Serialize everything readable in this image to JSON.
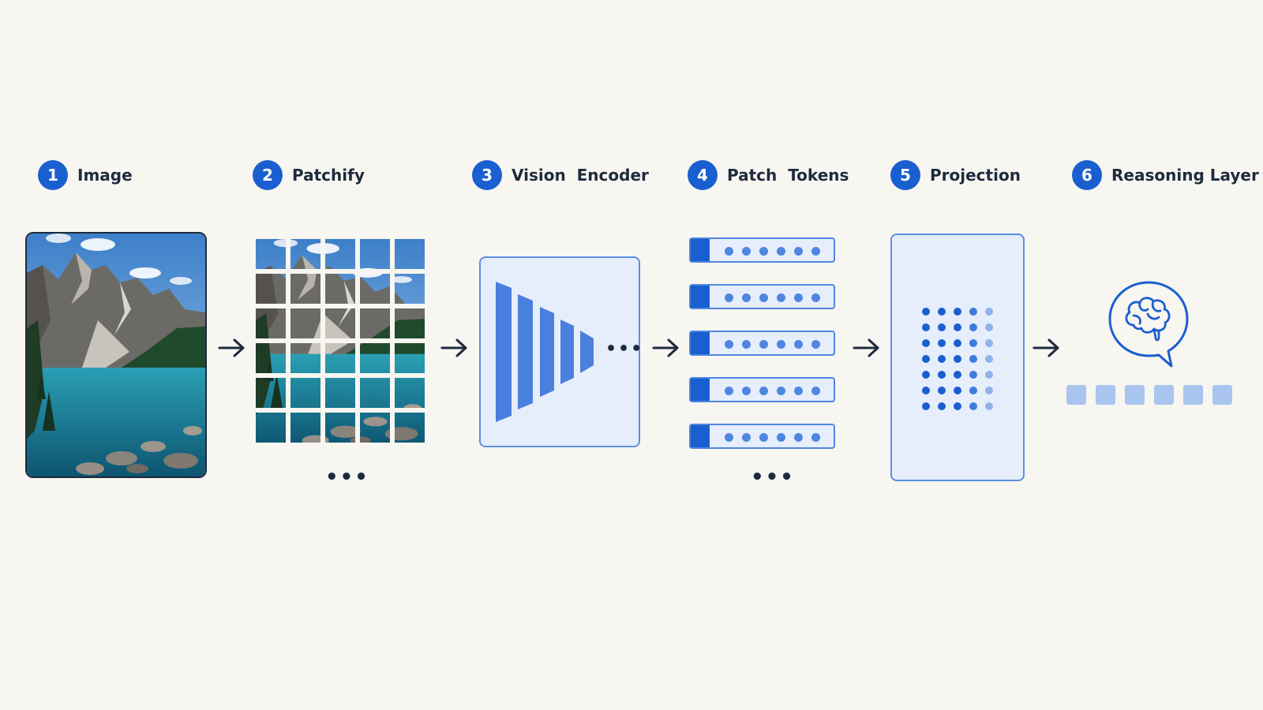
{
  "steps": [
    {
      "number": "1",
      "title": "Image"
    },
    {
      "number": "2",
      "title": "Patchify"
    },
    {
      "number": "3",
      "title": "Vision  Encoder"
    },
    {
      "number": "4",
      "title": "Patch  Tokens"
    },
    {
      "number": "5",
      "title": "Projection"
    },
    {
      "number": "6",
      "title": "Reasoning Layer"
    }
  ],
  "ellipsis": "•••",
  "icons": {
    "arrow": "right-arrow-icon",
    "reasoning": "brain-speech-bubble-icon"
  },
  "colors": {
    "accent": "#1a5fd0",
    "light_accent": "#4f86e0",
    "panel_fill": "#e6eefb",
    "text": "#1f2a3d",
    "background": "#f8f6f1"
  }
}
